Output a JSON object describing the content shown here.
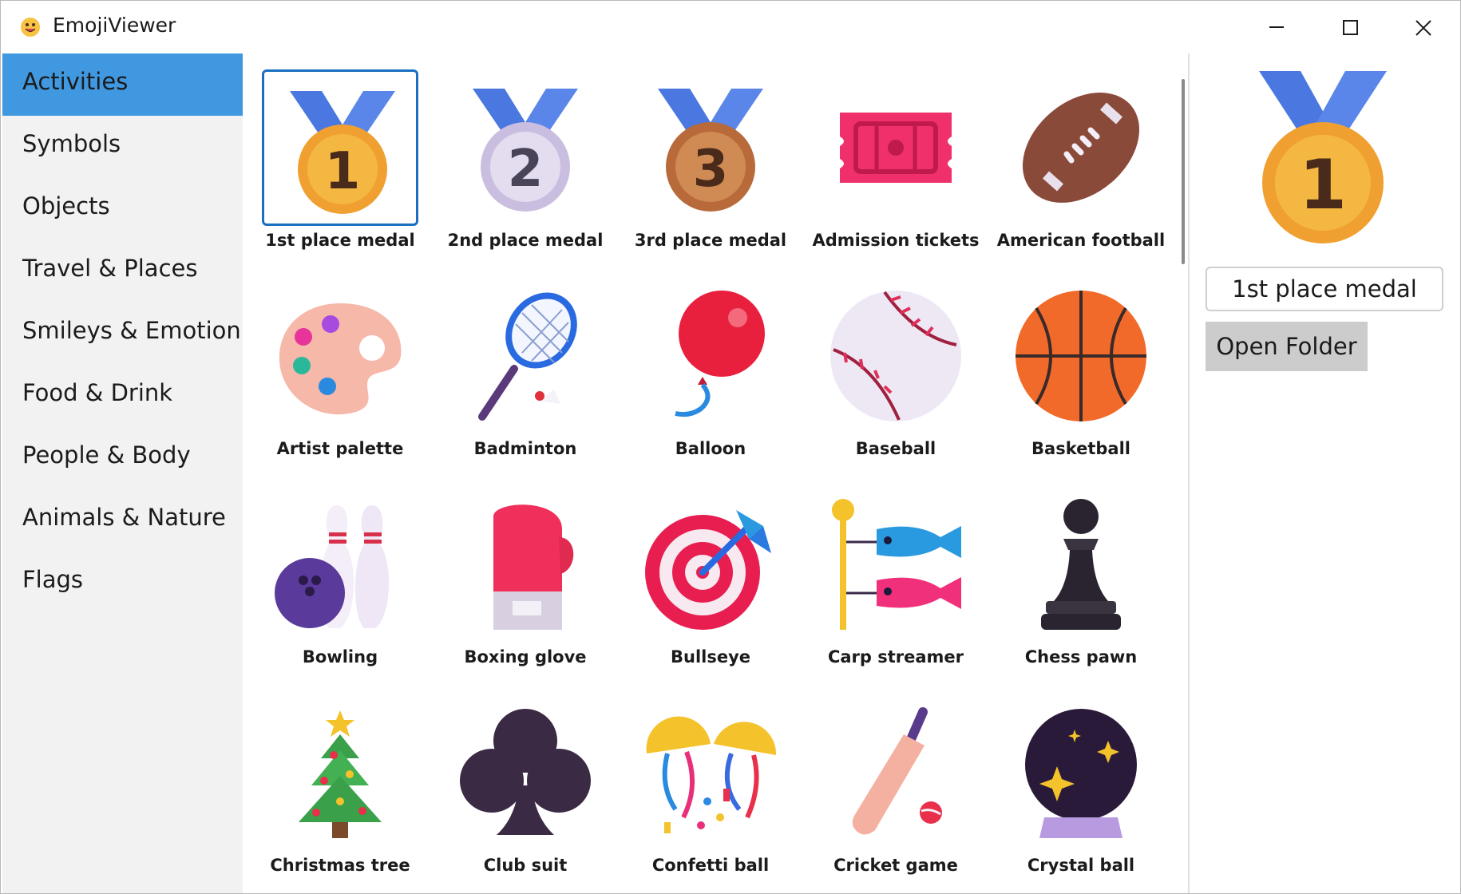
{
  "window": {
    "title": "EmojiViewer"
  },
  "nav": {
    "items": [
      {
        "label": "Activities",
        "selected": true
      },
      {
        "label": "Symbols"
      },
      {
        "label": "Objects"
      },
      {
        "label": "Travel & Places"
      },
      {
        "label": "Smileys & Emotion"
      },
      {
        "label": "Food & Drink"
      },
      {
        "label": "People & Body"
      },
      {
        "label": "Animals & Nature"
      },
      {
        "label": "Flags"
      }
    ]
  },
  "emojis": [
    {
      "label": "1st place medal",
      "icon": "first-place-medal"
    },
    {
      "label": "2nd place medal",
      "icon": "second-place-medal"
    },
    {
      "label": "3rd place medal",
      "icon": "third-place-medal"
    },
    {
      "label": "Admission tickets",
      "icon": "admission-tickets"
    },
    {
      "label": "American football",
      "icon": "american-football"
    },
    {
      "label": "Artist palette",
      "icon": "artist-palette"
    },
    {
      "label": "Badminton",
      "icon": "badminton"
    },
    {
      "label": "Balloon",
      "icon": "balloon"
    },
    {
      "label": "Baseball",
      "icon": "baseball"
    },
    {
      "label": "Basketball",
      "icon": "basketball"
    },
    {
      "label": "Bowling",
      "icon": "bowling"
    },
    {
      "label": "Boxing glove",
      "icon": "boxing-glove"
    },
    {
      "label": "Bullseye",
      "icon": "bullseye"
    },
    {
      "label": "Carp streamer",
      "icon": "carp-streamer"
    },
    {
      "label": "Chess pawn",
      "icon": "chess-pawn"
    },
    {
      "label": "Christmas tree",
      "icon": "christmas-tree"
    },
    {
      "label": "Club suit",
      "icon": "club-suit"
    },
    {
      "label": "Confetti ball",
      "icon": "confetti-ball"
    },
    {
      "label": "Cricket game",
      "icon": "cricket-game"
    },
    {
      "label": "Crystal ball",
      "icon": "crystal-ball"
    }
  ],
  "detail": {
    "selected_name": "1st place medal",
    "open_folder_label": "Open Folder"
  },
  "colors": {
    "accent": "#3f98e0",
    "selection_border": "#1a6fc1",
    "nav_background": "#f2f2f2"
  }
}
